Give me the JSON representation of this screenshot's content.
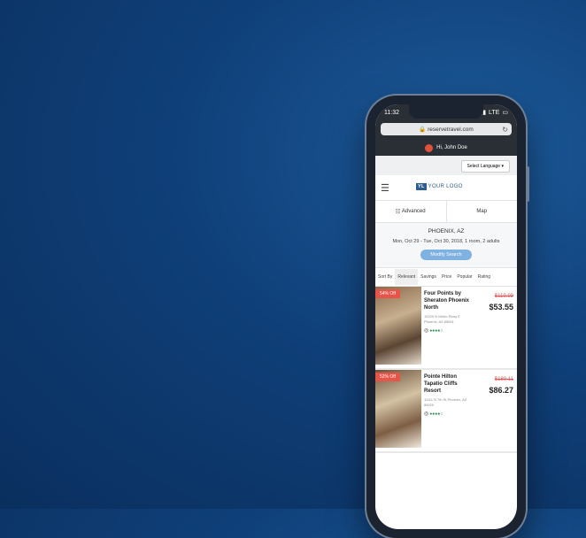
{
  "status": {
    "time": "11:32",
    "network": "LTE"
  },
  "browser": {
    "url": "reservetravel.com",
    "reload_icon": "reload-icon"
  },
  "user": {
    "greeting": "Hi, John Doe"
  },
  "language": {
    "label": "Select Language"
  },
  "header": {
    "logo_mark": "YL",
    "logo_text": "YOUR LOGO"
  },
  "toggles": {
    "advanced": "Advanced",
    "map": "Map"
  },
  "search": {
    "location": "PHOENIX, AZ",
    "dates": "Mon, Oct 29 - Tue, Oct 30, 2018, 1 room, 2 adults",
    "modify": "Modify Search"
  },
  "sort": {
    "label": "Sort By",
    "options": [
      "Relevant",
      "Savings",
      "Price",
      "Popular",
      "Rating"
    ]
  },
  "hotels": [
    {
      "badge": "54% Off",
      "name": "Four Points by Sheraton Phoenix North",
      "address": "10220 N Metro Pkwy E Phoenix, AZ 85051",
      "old_price": "$119.99",
      "price": "$53.55",
      "rating": "●●●●○"
    },
    {
      "badge": "52% Off",
      "name": "Pointe Hilton Tapatio Cliffs Resort",
      "address": "11111 N 7th St Phoenix, AZ 85020",
      "old_price": "$180.11",
      "price": "$86.27",
      "rating": "●●●●○"
    }
  ]
}
